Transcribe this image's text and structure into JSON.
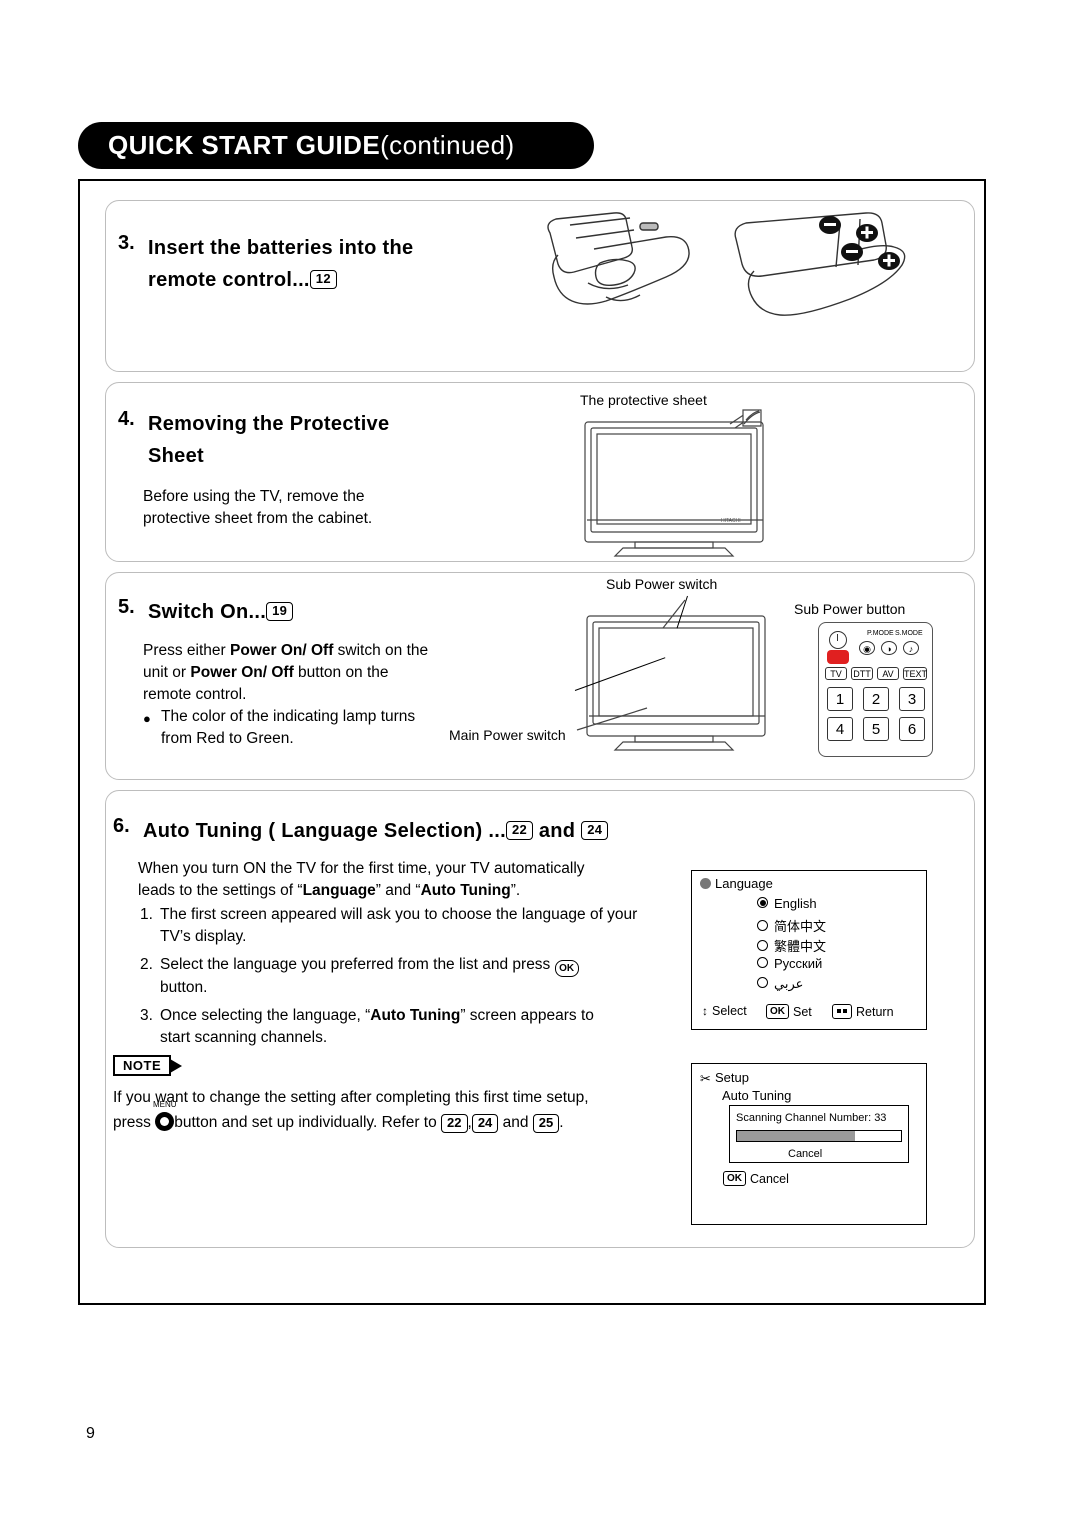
{
  "header": {
    "title_bold": "QUICK START GUIDE",
    "title_cont": " (continued)"
  },
  "page_number": "9",
  "sections": [
    {
      "num": "3.",
      "title_line1": "Insert the batteries into the",
      "title_line2": "remote control...",
      "ref_page": "12"
    },
    {
      "num": "4.",
      "title_line1": "Removing the Protective",
      "title_line2": "Sheet",
      "body_line1": "Before using the TV, remove the",
      "body_line2": "protective sheet from the cabinet.",
      "caption": "The protective sheet"
    },
    {
      "num": "5.",
      "title": "Switch On...",
      "ref_page": "19",
      "body_l1_a": "Press either ",
      "body_l1_b": "Power On/ Off",
      "body_l1_c": " switch on the",
      "body_l2_a": "unit or ",
      "body_l2_b": "Power On/ Off",
      "body_l2_c": " button on the",
      "body_l3": "remote control.",
      "bullet_l1": "The color of the indicating lamp turns",
      "bullet_l2": "from Red to Green.",
      "caption_sub_switch": "Sub Power switch",
      "caption_sub_button": "Sub Power button",
      "caption_main_switch": "Main Power switch",
      "remote": {
        "top_labels": [
          "P.MODE",
          "S.MODE"
        ],
        "mode_keys": [
          "TV",
          "DTT",
          "AV",
          "TEXT"
        ],
        "numbers": [
          "1",
          "2",
          "3",
          "4",
          "5",
          "6"
        ]
      }
    },
    {
      "num": "6.",
      "title": "Auto Tuning ( Language Selection) ...",
      "ref_page_1": "22",
      "and_text": "and",
      "ref_page_2": "24",
      "intro_l1": "When you turn ON the TV for the first time, your TV automatically",
      "intro_l2_a": "leads to the settings of “",
      "intro_l2_b": "Language",
      "intro_l2_c": "” and “",
      "intro_l2_d": "Auto Tuning",
      "intro_l2_e": "”.",
      "steps": [
        {
          "num": "1.",
          "line1": "The first screen appeared will ask you to choose the language of your",
          "line2": "TV’s display."
        },
        {
          "num": "2.",
          "line1_a": "Select the language you preferred from the list and press ",
          "ok": "OK",
          "line2": "button."
        },
        {
          "num": "3.",
          "line1_a": "Once selecting the language, “",
          "line1_b": "Auto Tuning",
          "line1_c": "” screen appears to",
          "line2": "start scanning channels."
        }
      ],
      "note_label": "NOTE",
      "note_l1": "If you want to change the setting after completing this first time setup,",
      "note_l2_a": "press ",
      "note_menu_label": "MENU",
      "note_l2_b": "button and set up individually. Refer to ",
      "note_ref1": "22",
      "note_sep": ",",
      "note_ref2": "24",
      "note_and": "and",
      "note_ref3": "25",
      "note_end": "."
    }
  ],
  "osd_language": {
    "title": "Language",
    "options": [
      {
        "label": "English",
        "selected": true
      },
      {
        "label": "简体中文",
        "selected": false
      },
      {
        "label": "繁體中文",
        "selected": false
      },
      {
        "label": "Русский",
        "selected": false
      },
      {
        "label": "عربي",
        "selected": false
      }
    ],
    "footer_select": "Select",
    "footer_set_key": "OK",
    "footer_set": "Set",
    "footer_return": "Return"
  },
  "osd_setup": {
    "title": "Setup",
    "subtitle": "Auto Tuning",
    "scan_text": "Scanning Channel Number: 33",
    "progress_percent": 72,
    "cancel_inner": "Cancel",
    "footer_key": "OK",
    "footer_cancel": "Cancel"
  }
}
